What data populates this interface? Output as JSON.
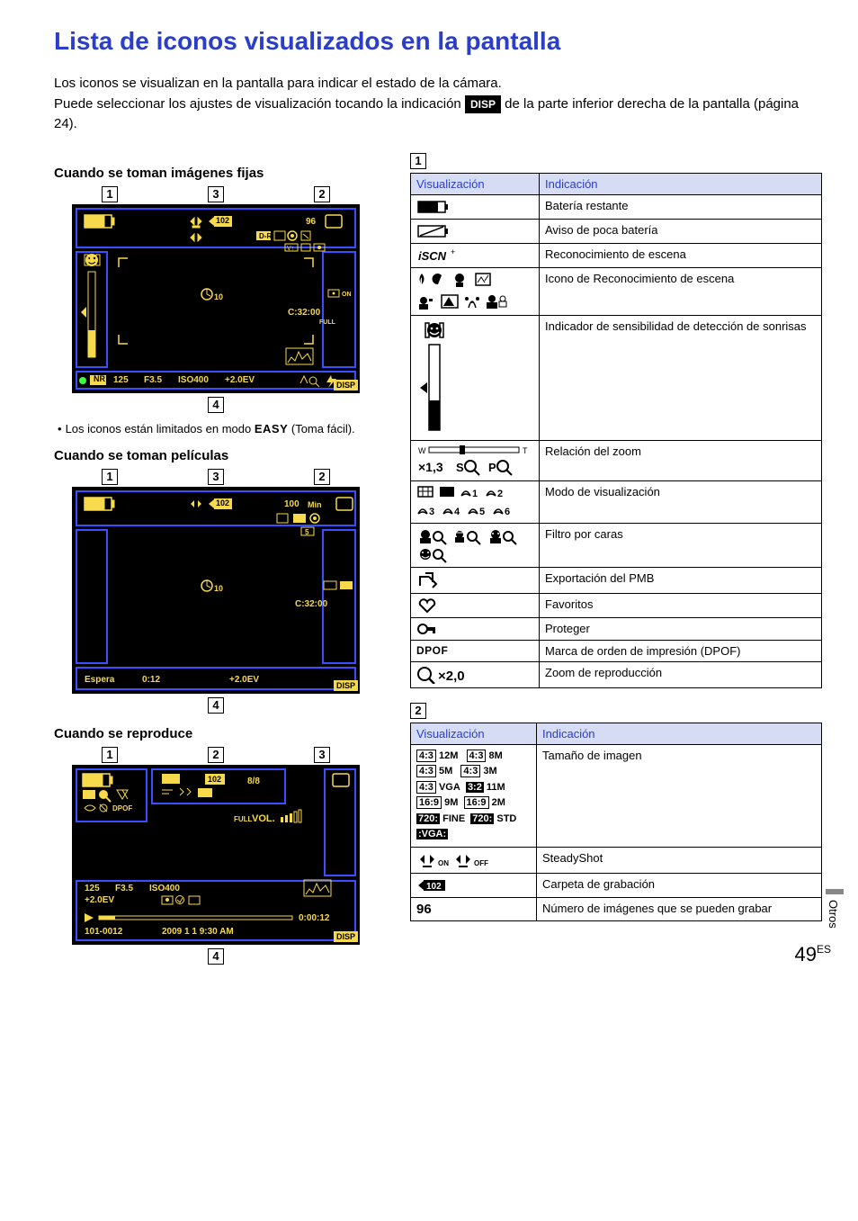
{
  "title": "Lista de iconos visualizados en la pantalla",
  "intro": {
    "line1": "Los iconos se visualizan en la pantalla para indicar el estado de la cámara.",
    "line2a": "Puede seleccionar los ajustes de visualización tocando la indicación ",
    "disp_label": "DISP",
    "line2b": " de la parte inferior derecha de la pantalla (página 24)."
  },
  "sections": {
    "fixed_heading": "Cuando se toman imágenes fijas",
    "movie_heading": "Cuando se toman películas",
    "play_heading": "Cuando se reproduce"
  },
  "note": {
    "bullet": "•",
    "text_a": "Los iconos están limitados en modo ",
    "easy": "EASY",
    "text_b": " (Toma fácil)."
  },
  "lcd_fixed": {
    "count": "96",
    "folder": "102",
    "timer": "10",
    "code": "C:32:00",
    "full": "FULL",
    "shutter": "125",
    "fnum": "F3.5",
    "iso": "ISO400",
    "ev": "+2.0EV",
    "disp": "DISP",
    "nr": "NR",
    "dr": "D-R",
    "on": "ON"
  },
  "lcd_movie": {
    "count": "100",
    "min": "Min",
    "folder": "102",
    "timer": "10",
    "code": "C:32:00",
    "standby": "Espera",
    "time": "0:12",
    "ev": "+2.0EV",
    "disp": "DISP",
    "st": "5"
  },
  "lcd_play": {
    "folder": "102",
    "idx": "8/8",
    "vol": "VOL.",
    "full": "FULL",
    "shutter": "125",
    "fnum": "F3.5",
    "iso": "ISO400",
    "ev": "+2.0EV",
    "file": "101-0012",
    "date": "2009  1  1  9:30 AM",
    "time": "0:00:12",
    "disp": "DISP",
    "dpof": "DPOF"
  },
  "callouts": {
    "c1": "1",
    "c2": "2",
    "c3": "3",
    "c4": "4"
  },
  "table1": {
    "section": "1",
    "h1": "Visualización",
    "h2": "Indicación",
    "rows": {
      "battery": "Batería restante",
      "low_batt": "Aviso de poca batería",
      "scn": "Reconocimiento de escena",
      "scn_icons": "Icono de Reconocimiento de escena",
      "smile": "Indicador de sensibilidad de detección de sonrisas",
      "zoom_label": "×1,3",
      "zoom_sq": "sQ",
      "zoom_pq": "PQ",
      "zoom": "Relación del zoom",
      "view_nums": "1 2 3 4 5 6",
      "view": "Modo de visualización",
      "face_filter": "Filtro por caras",
      "pmb": "Exportación del PMB",
      "fav": "Favoritos",
      "protect": "Proteger",
      "dpof_label": "DPOF",
      "dpof": "Marca de orden de impresión (DPOF)",
      "playzoom_label": "×2,0",
      "playzoom": "Zoom de reproducción"
    }
  },
  "table2": {
    "section": "2",
    "h1": "Visualización",
    "h2": "Indicación",
    "rows": {
      "size_labels": {
        "a43": "4:3",
        "a32": "3:2",
        "a169": "16:9",
        "a720": "720:",
        "m12": "12M",
        "m8": "8M",
        "m5": "5M",
        "m3": "3M",
        "vga": "VGA",
        "m11": "11M",
        "m9": "9M",
        "m2": "2M",
        "fine": "FINE",
        "std": "STD",
        "vga2": ":VGA:"
      },
      "size": "Tamaño de imagen",
      "steady_on": "ON",
      "steady_off": "OFF",
      "steady": "SteadyShot",
      "folder_num": "102",
      "folder": "Carpeta de grabación",
      "remain_num": "96",
      "remain": "Número de imágenes que se pueden grabar"
    }
  },
  "side_tab": "Otros",
  "page": {
    "num": "49",
    "lang": "ES"
  }
}
